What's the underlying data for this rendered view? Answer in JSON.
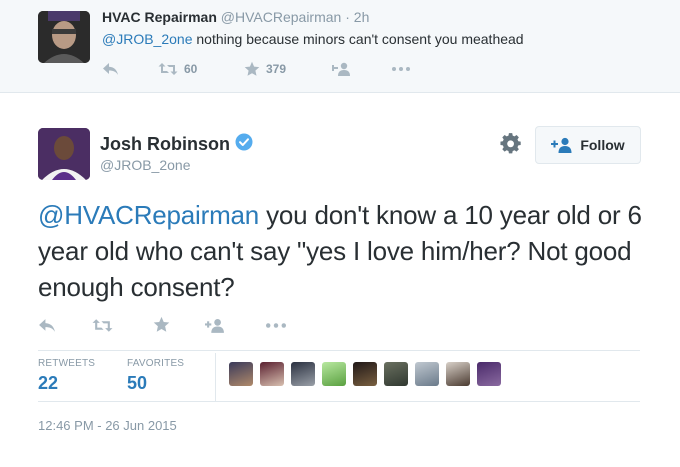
{
  "reply_tweet": {
    "display_name": "HVAC Repairman",
    "handle": "@HVACRepairman",
    "separator": "·",
    "time": "2h",
    "mention": "@JROB_2one",
    "text": " nothing because minors can't consent you meathead",
    "retweet_count": "60",
    "favorite_count": "379",
    "reply_icon": "reply-icon",
    "retweet_icon": "retweet-icon",
    "favorite_icon": "star-icon",
    "follow_icon": "follow-plus-icon",
    "more_icon": "more-dots-icon"
  },
  "main_tweet": {
    "display_name": "Josh Robinson",
    "handle": "@JROB_2one",
    "verified_icon": "verified-badge-icon",
    "settings_icon": "gear-icon",
    "follow_button_label": "Follow",
    "text_mention": "@HVACRepairman",
    "text_body": " you don't know a 10 year old or 6 year old who can't say \"yes I love him/her? Not good enough consent?",
    "stats": {
      "retweets_label": "RETWEETS",
      "retweets_value": "22",
      "favorites_label": "FAVORITES",
      "favorites_value": "50"
    },
    "timestamp": "12:46 PM - 26 Jun 2015"
  },
  "colors": {
    "link": "#2b7bb9",
    "muted": "#8899a6",
    "icon": "#aab8c2",
    "verified": "#55acee",
    "reply_bg": "#f5f8fa"
  }
}
